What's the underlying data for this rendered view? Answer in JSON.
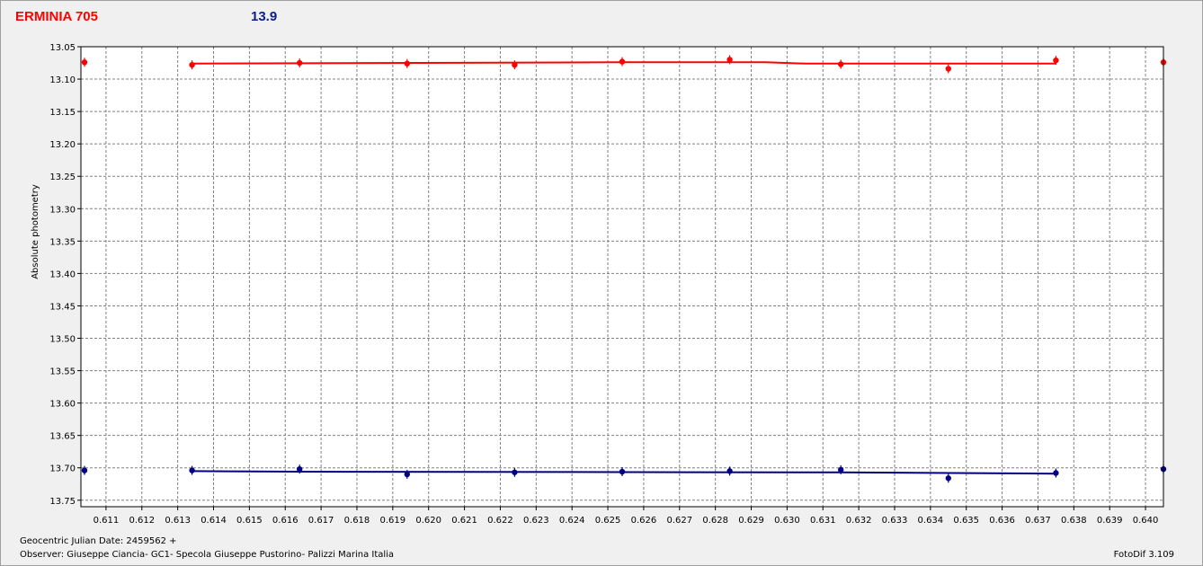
{
  "header": {
    "object_name": "ERMINIA 705",
    "magnitude": "13.9"
  },
  "footer": {
    "jd_label": "Geocentric Julian Date: 2459562 +",
    "observer": "Observer: Giuseppe Ciancia- GC1- Specola Giuseppe Pustorino- Palizzi Marina Italia",
    "version": "FotoDif 3.109"
  },
  "colors": {
    "red_series": "#ff0000",
    "blue_series": "#000080",
    "grid": "#808080",
    "plot_bg": "#ffffff",
    "window_bg": "#f0f0f0"
  },
  "chart_data": {
    "type": "scatter",
    "ylabel": "Absolute photometry",
    "xlabel": "Geocentric Julian Date: 2459562 +",
    "xlim": [
      0.6103,
      0.6405
    ],
    "ylim": [
      13.05,
      13.76
    ],
    "y_inverted": true,
    "grid": true,
    "xticks": [
      "0.611",
      "0.612",
      "0.613",
      "0.614",
      "0.615",
      "0.616",
      "0.617",
      "0.618",
      "0.619",
      "0.620",
      "0.621",
      "0.622",
      "0.623",
      "0.624",
      "0.625",
      "0.626",
      "0.627",
      "0.628",
      "0.629",
      "0.630",
      "0.631",
      "0.632",
      "0.633",
      "0.634",
      "0.635",
      "0.636",
      "0.637",
      "0.638",
      "0.639",
      "0.640"
    ],
    "yticks": [
      "13.05",
      "13.10",
      "13.15",
      "13.20",
      "13.25",
      "13.30",
      "13.35",
      "13.40",
      "13.45",
      "13.50",
      "13.55",
      "13.60",
      "13.65",
      "13.70",
      "13.75"
    ],
    "series": [
      {
        "color": "#ff0000",
        "x": [
          0.6104,
          0.6134,
          0.6164,
          0.6194,
          0.6224,
          0.6254,
          0.6284,
          0.6315,
          0.6345,
          0.6375,
          0.6405
        ],
        "y": [
          13.074,
          13.078,
          13.075,
          13.076,
          13.078,
          13.073,
          13.07,
          13.077,
          13.084,
          13.071,
          13.074
        ],
        "fit": [
          [
            0.6134,
            13.076
          ],
          [
            0.6254,
            13.074
          ],
          [
            0.6294,
            13.074
          ],
          [
            0.6305,
            13.076
          ],
          [
            0.6375,
            13.076
          ]
        ]
      },
      {
        "color": "#000080",
        "x": [
          0.6104,
          0.6134,
          0.6164,
          0.6194,
          0.6224,
          0.6254,
          0.6284,
          0.6315,
          0.6345,
          0.6375,
          0.6405
        ],
        "y": [
          13.704,
          13.704,
          13.702,
          13.71,
          13.707,
          13.706,
          13.705,
          13.703,
          13.716,
          13.708,
          13.702
        ],
        "fit": [
          [
            0.6134,
            13.705
          ],
          [
            0.6164,
            13.706
          ],
          [
            0.6315,
            13.707
          ],
          [
            0.6375,
            13.709
          ]
        ]
      }
    ]
  }
}
